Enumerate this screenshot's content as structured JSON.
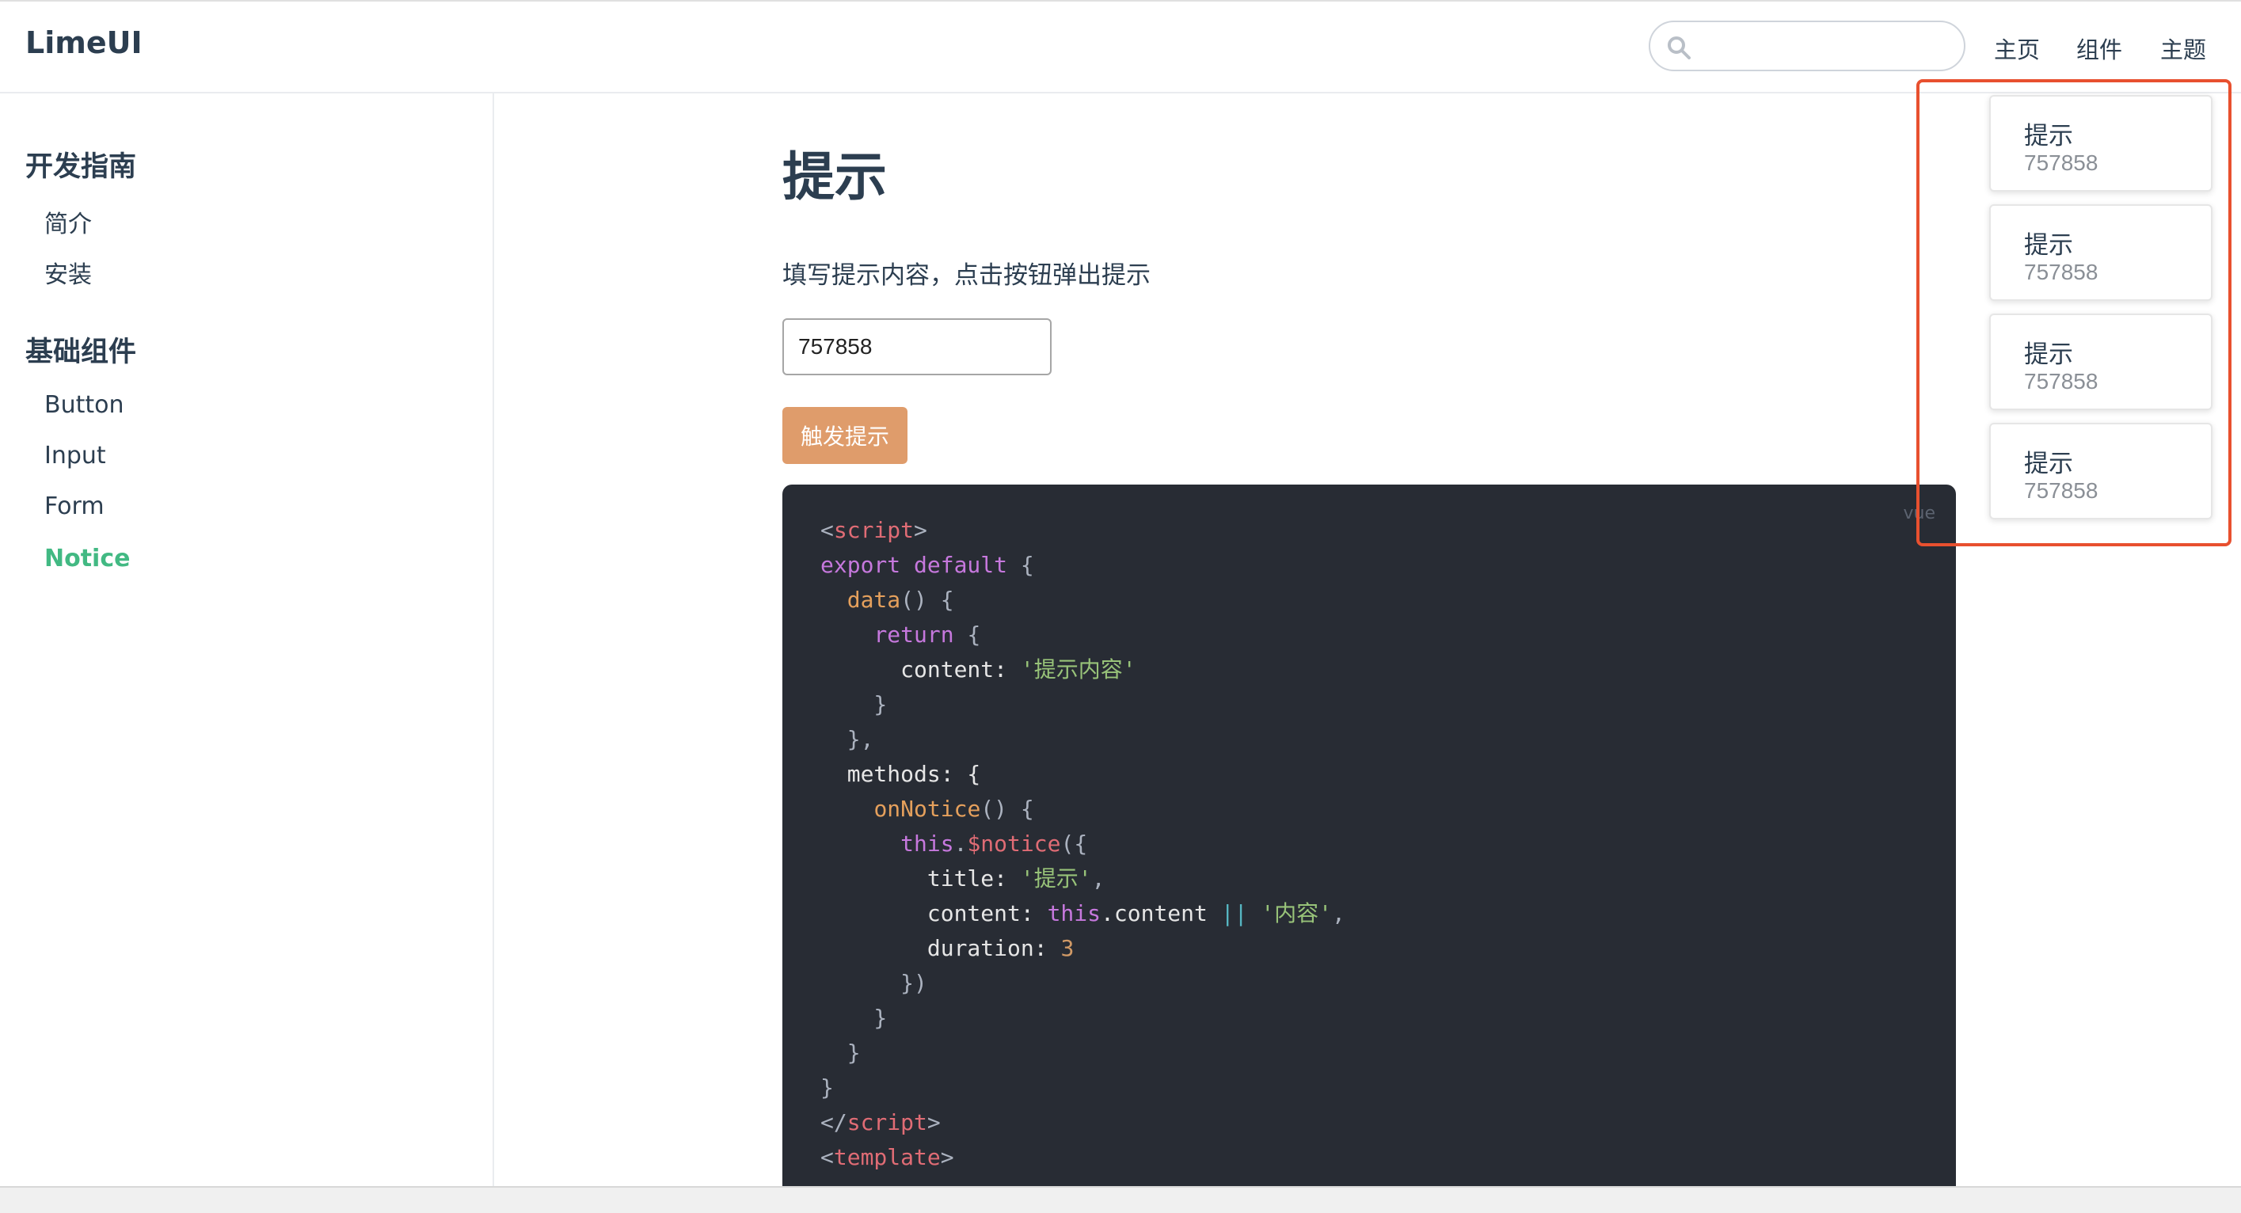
{
  "header": {
    "logo": "LimeUI",
    "search_value": "",
    "nav": {
      "home": "主页",
      "components": "组件",
      "theme": "主题"
    }
  },
  "sidebar": {
    "groups": [
      {
        "title": "开发指南",
        "items": [
          "简介",
          "安装"
        ]
      },
      {
        "title": "基础组件",
        "items": [
          "Button",
          "Input",
          "Form",
          "Notice"
        ]
      }
    ],
    "active_item": "Notice"
  },
  "main": {
    "title": "提示",
    "description": "填写提示内容，点击按钮弹出提示",
    "input_value": "757858",
    "button_label": "触发提示"
  },
  "code": {
    "lang": "vue",
    "lines": [
      [
        {
          "t": "<",
          "c": "punc"
        },
        {
          "t": "script",
          "c": "tag"
        },
        {
          "t": ">",
          "c": "punc"
        }
      ],
      [
        {
          "t": "export default",
          "c": "kw"
        },
        {
          "t": " {",
          "c": "punc"
        }
      ],
      [
        {
          "t": "  ",
          "c": "plain"
        },
        {
          "t": "data",
          "c": "fn"
        },
        {
          "t": "() {",
          "c": "punc"
        }
      ],
      [
        {
          "t": "    ",
          "c": "plain"
        },
        {
          "t": "return",
          "c": "kw"
        },
        {
          "t": " {",
          "c": "punc"
        }
      ],
      [
        {
          "t": "      content: ",
          "c": "plain"
        },
        {
          "t": "'提示内容'",
          "c": "str"
        }
      ],
      [
        {
          "t": "    }",
          "c": "punc"
        }
      ],
      [
        {
          "t": "  },",
          "c": "punc"
        }
      ],
      [
        {
          "t": "  methods: {",
          "c": "plain"
        }
      ],
      [
        {
          "t": "    ",
          "c": "plain"
        },
        {
          "t": "onNotice",
          "c": "fn"
        },
        {
          "t": "() {",
          "c": "punc"
        }
      ],
      [
        {
          "t": "      ",
          "c": "plain"
        },
        {
          "t": "this",
          "c": "kw"
        },
        {
          "t": ".",
          "c": "punc"
        },
        {
          "t": "$notice",
          "c": "tag"
        },
        {
          "t": "({",
          "c": "punc"
        }
      ],
      [
        {
          "t": "        title: ",
          "c": "plain"
        },
        {
          "t": "'提示'",
          "c": "str"
        },
        {
          "t": ",",
          "c": "punc"
        }
      ],
      [
        {
          "t": "        content: ",
          "c": "plain"
        },
        {
          "t": "this",
          "c": "kw"
        },
        {
          "t": ".content ",
          "c": "plain"
        },
        {
          "t": "||",
          "c": "op"
        },
        {
          "t": " ",
          "c": "plain"
        },
        {
          "t": "'内容'",
          "c": "str"
        },
        {
          "t": ",",
          "c": "punc"
        }
      ],
      [
        {
          "t": "        duration: ",
          "c": "plain"
        },
        {
          "t": "3",
          "c": "num"
        }
      ],
      [
        {
          "t": "      })",
          "c": "punc"
        }
      ],
      [
        {
          "t": "    }",
          "c": "punc"
        }
      ],
      [
        {
          "t": "  }",
          "c": "punc"
        }
      ],
      [
        {
          "t": "}",
          "c": "punc"
        }
      ],
      [
        {
          "t": "</",
          "c": "punc"
        },
        {
          "t": "script",
          "c": "tag"
        },
        {
          "t": ">",
          "c": "punc"
        }
      ],
      [
        {
          "t": "<",
          "c": "punc"
        },
        {
          "t": "template",
          "c": "tag"
        },
        {
          "t": ">",
          "c": "punc"
        }
      ]
    ]
  },
  "notices": [
    {
      "title": "提示",
      "content": "757858"
    },
    {
      "title": "提示",
      "content": "757858"
    },
    {
      "title": "提示",
      "content": "757858"
    },
    {
      "title": "提示",
      "content": "757858"
    }
  ],
  "colors": {
    "accent": "#42b983",
    "button": "#df9c6b",
    "highlight": "#e8502f",
    "code_bg": "#282c34"
  }
}
